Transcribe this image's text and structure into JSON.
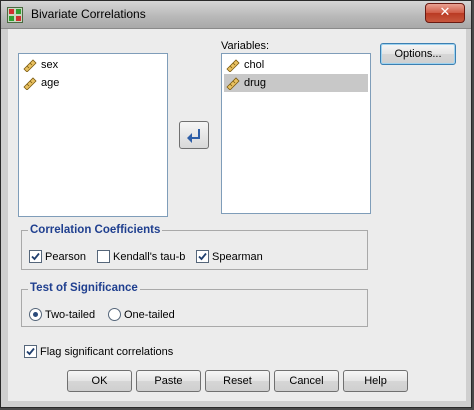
{
  "window": {
    "title": "Bivariate Correlations",
    "close_glyph": "✕"
  },
  "source_list": {
    "items": [
      {
        "label": "sex",
        "icon": "scale-ruler-icon"
      },
      {
        "label": "age",
        "icon": "scale-ruler-icon"
      }
    ]
  },
  "variables": {
    "label": "Variables:",
    "items": [
      {
        "label": "chol",
        "selected": false
      },
      {
        "label": "drug",
        "selected": true
      }
    ]
  },
  "options_button": "Options...",
  "correlation": {
    "title": "Correlation Coefficients",
    "pearson": {
      "label": "Pearson",
      "checked": true
    },
    "kendall": {
      "label": "Kendall's tau-b",
      "checked": false
    },
    "spearman": {
      "label": "Spearman",
      "checked": true
    }
  },
  "significance": {
    "title": "Test of Significance",
    "two_tailed": {
      "label": "Two-tailed",
      "selected": true
    },
    "one_tailed": {
      "label": "One-tailed",
      "selected": false
    }
  },
  "flag": {
    "label": "Flag significant correlations",
    "checked": true
  },
  "buttons": {
    "ok": "OK",
    "paste": "Paste",
    "reset": "Reset",
    "cancel": "Cancel",
    "help": "Help"
  },
  "colors": {
    "group_title": "#1f3f8f",
    "selection": "#c8c8c8",
    "arrow": "#2f5fa8"
  }
}
